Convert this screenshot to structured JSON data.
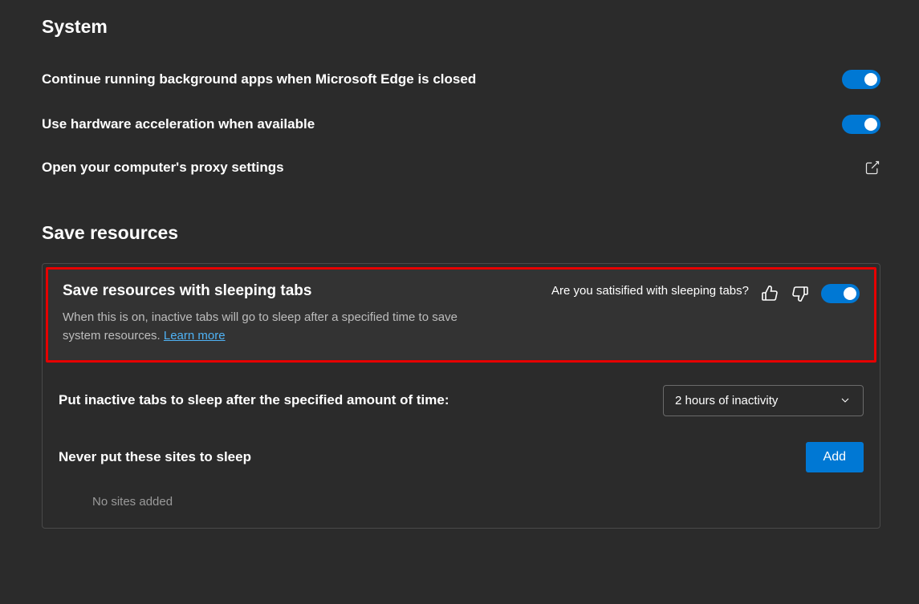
{
  "system": {
    "title": "System",
    "rows": {
      "bg_apps": "Continue running background apps when Microsoft Edge is closed",
      "hw_accel": "Use hardware acceleration when available",
      "proxy": "Open your computer's proxy settings"
    }
  },
  "save": {
    "title": "Save resources",
    "sleeping": {
      "title": "Save resources with sleeping tabs",
      "desc": "When this is on, inactive tabs will go to sleep after a specified time to save system resources. ",
      "learn_more": "Learn more",
      "feedback_q": "Are you satisified with sleeping tabs?"
    },
    "inactive_label": "Put inactive tabs to sleep after the specified amount of time:",
    "inactive_value": "2 hours of inactivity",
    "never_label": "Never put these sites to sleep",
    "add_label": "Add",
    "empty": "No sites added"
  },
  "colors": {
    "accent": "#0078d4",
    "highlight_border": "#e60000"
  }
}
